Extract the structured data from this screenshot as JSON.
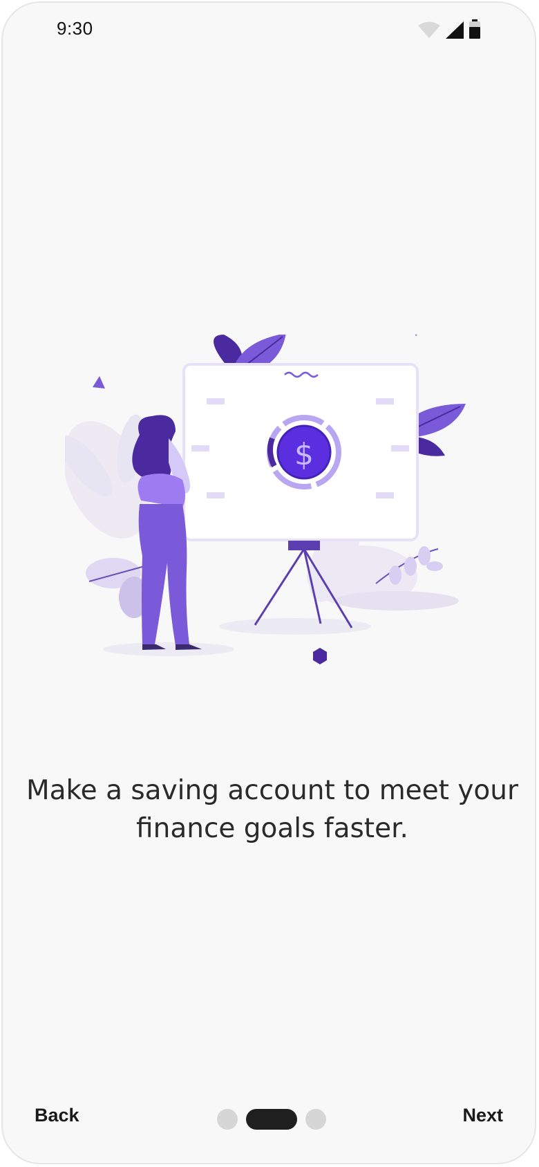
{
  "status_bar": {
    "time": "9:30",
    "icons": [
      "wifi-icon",
      "cellular-signal-icon",
      "battery-icon"
    ]
  },
  "illustration": {
    "description_icon": "savings-illustration",
    "currency_symbol": "$"
  },
  "onboarding": {
    "headline": "Make a saving account to meet your finance goals faster.",
    "page_count": 3,
    "current_page": 2
  },
  "navigation": {
    "back_label": "Back",
    "next_label": "Next"
  },
  "colors": {
    "background": "#f8f8f8",
    "accent": "#5b2fe0",
    "accent_light": "#a58cf0",
    "accent_pale": "#e7e2f6",
    "text": "#2a2a2a",
    "pager_active": "#1f1f1f",
    "pager_inactive": "#d6d6d6"
  }
}
